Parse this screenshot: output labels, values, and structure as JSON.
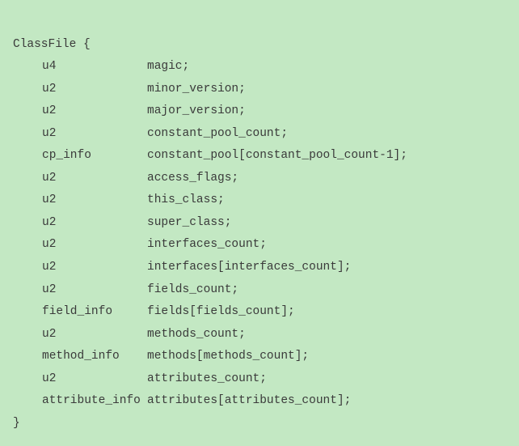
{
  "struct_name": "ClassFile",
  "open_brace": "{",
  "close_brace": "}",
  "fields": [
    {
      "type": "u4",
      "name": "magic;"
    },
    {
      "type": "u2",
      "name": "minor_version;"
    },
    {
      "type": "u2",
      "name": "major_version;"
    },
    {
      "type": "u2",
      "name": "constant_pool_count;"
    },
    {
      "type": "cp_info",
      "name": "constant_pool[constant_pool_count-1];"
    },
    {
      "type": "u2",
      "name": "access_flags;"
    },
    {
      "type": "u2",
      "name": "this_class;"
    },
    {
      "type": "u2",
      "name": "super_class;"
    },
    {
      "type": "u2",
      "name": "interfaces_count;"
    },
    {
      "type": "u2",
      "name": "interfaces[interfaces_count];"
    },
    {
      "type": "u2",
      "name": "fields_count;"
    },
    {
      "type": "field_info",
      "name": "fields[fields_count];"
    },
    {
      "type": "u2",
      "name": "methods_count;"
    },
    {
      "type": "method_info",
      "name": "methods[methods_count];"
    },
    {
      "type": "u2",
      "name": "attributes_count;"
    },
    {
      "type": "attribute_info",
      "name": "attributes[attributes_count];"
    }
  ]
}
